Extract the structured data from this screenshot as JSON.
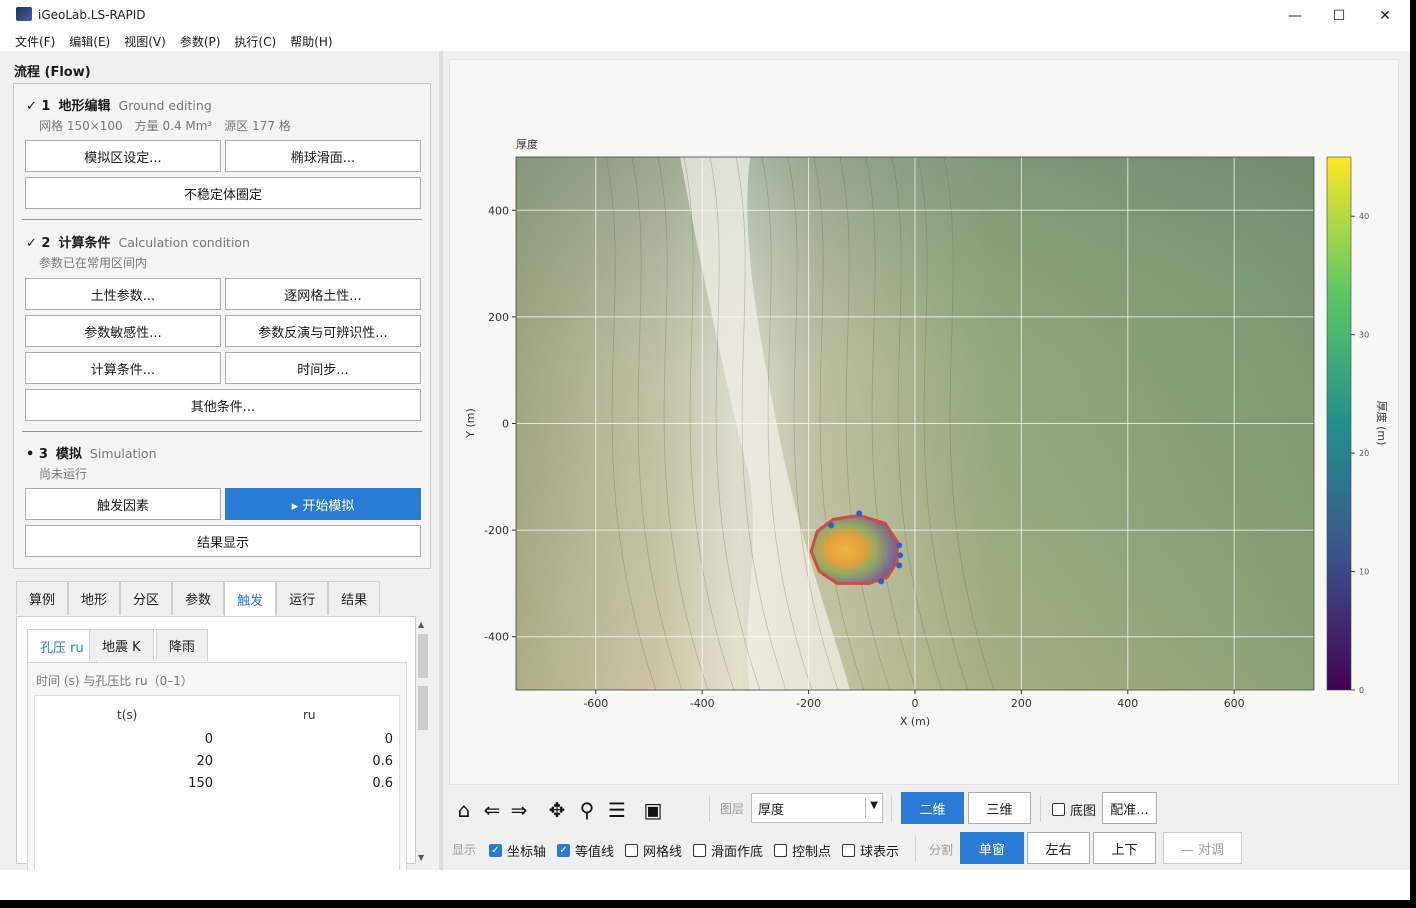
{
  "window": {
    "title": "iGeoLab.LS-RAPID",
    "minimize": "—",
    "maximize": "☐",
    "close": "✕"
  },
  "menu": [
    "文件(F)",
    "编辑(E)",
    "视图(V)",
    "参数(P)",
    "执行(C)",
    "帮助(H)"
  ],
  "flow": {
    "title": "流程 (Flow)",
    "steps": [
      {
        "mark": "✓ 1",
        "cn": "地形编辑",
        "en": "Ground editing",
        "sub": "网格 150×100　方量 0.4 Mm³　源区 177 格",
        "buttons": [
          "模拟区设定...",
          "椭球滑面...",
          "不稳定体圈定"
        ]
      },
      {
        "mark": "✓ 2",
        "cn": "计算条件",
        "en": "Calculation condition",
        "sub": "参数已在常用区间内",
        "buttons": [
          "土性参数...",
          "逐网格土性...",
          "参数敏感性...",
          "参数反演与可辨识性...",
          "计算条件...",
          "时间步...",
          "其他条件..."
        ]
      },
      {
        "mark": "• 3",
        "cn": "模拟",
        "en": "Simulation",
        "sub": "尚未运行",
        "buttons": [
          "触发因素",
          "▸ 开始模拟",
          "结果显示"
        ]
      }
    ]
  },
  "tabs": [
    "算例",
    "地形",
    "分区",
    "参数",
    "触发",
    "运行",
    "结果"
  ],
  "active_tab": "触发",
  "subtabs": [
    "孔压 ru",
    "地震 K",
    "降雨"
  ],
  "active_subtab": "孔压 ru",
  "ru": {
    "caption": "时间 (s) 与孔压比 ru（0–1）",
    "headers": [
      "t(s)",
      "ru"
    ],
    "rows": [
      [
        "0",
        "0"
      ],
      [
        "20",
        "0.6"
      ],
      [
        "150",
        "0.6"
      ]
    ]
  },
  "plot": {
    "title": "厚度",
    "colorbar_label": "厚度 (m)",
    "colors": {
      "low": "#440154",
      "mid": "#21918c",
      "high": "#fde725",
      "outline": "#d43a2a",
      "points": "#2a5fd6"
    }
  },
  "chart_data": {
    "type": "heatmap",
    "title": "厚度",
    "xlabel": "X (m)",
    "ylabel": "Y (m)",
    "xlim": [
      -750,
      750
    ],
    "ylim": [
      -500,
      500
    ],
    "xticks": [
      -600,
      -400,
      -200,
      0,
      200,
      400,
      600
    ],
    "yticks": [
      -400,
      -200,
      0,
      200,
      400
    ],
    "colorbar": {
      "label": "厚度 (m)",
      "range": [
        0,
        45
      ],
      "ticks": [
        0,
        10,
        20,
        30,
        40
      ]
    },
    "grid": true,
    "mass": {
      "center": [
        -120,
        -240
      ],
      "peak_thickness": 25
    }
  },
  "toolbar": {
    "icons": [
      "home-icon",
      "back-icon",
      "forward-icon",
      "pan-icon",
      "zoom-icon",
      "settings-icon",
      "save-icon"
    ],
    "layer_label": "图层",
    "layer_value": "厚度",
    "view_2d": "二维",
    "view_3d": "三维",
    "basemap": "底图",
    "config": "配准...",
    "display_label": "显示",
    "checks": [
      {
        "label": "坐标轴",
        "on": true
      },
      {
        "label": "等值线",
        "on": true
      },
      {
        "label": "网格线",
        "on": false
      },
      {
        "label": "滑面作底",
        "on": false
      },
      {
        "label": "控制点",
        "on": false
      },
      {
        "label": "球表示",
        "on": false
      }
    ],
    "split_label": "分割",
    "split": [
      "单窗",
      "左右",
      "上下",
      "— 对调"
    ]
  }
}
